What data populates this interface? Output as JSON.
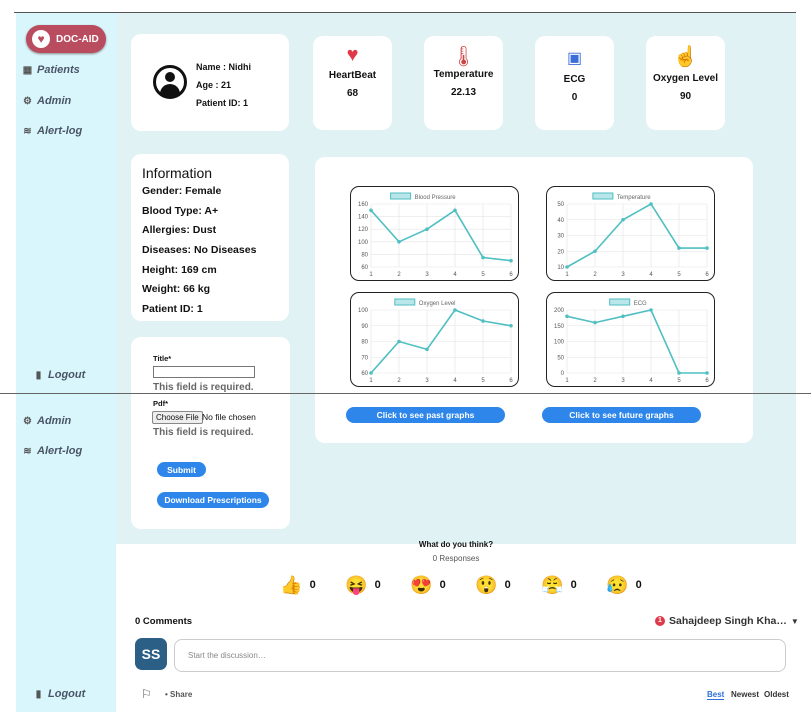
{
  "app": {
    "logo_text": "DOC-AID"
  },
  "nav": {
    "patients": "Patients",
    "admin": "Admin",
    "alert_log": "Alert-log",
    "logout": "Logout"
  },
  "patient": {
    "name": "Name : Nidhi",
    "age": "Age : 21",
    "id": "Patient ID: 1"
  },
  "vitals": [
    {
      "label": "HeartBeat",
      "value": "68",
      "icon": "heart-pulse-icon"
    },
    {
      "label": "Temperature",
      "value": "22.13",
      "icon": "thermometer-icon"
    },
    {
      "label": "ECG",
      "value": "0",
      "icon": "ecg-monitor-icon"
    },
    {
      "label": "Oxygen Level",
      "value": "90",
      "icon": "finger-oximeter-icon"
    }
  ],
  "info": {
    "title": "Information",
    "rows": [
      "Gender: Female",
      "Blood Type: A+",
      "Allergies: Dust",
      "Diseases: No Diseases",
      "Height: 169 cm",
      "Weight: 66 kg",
      "Patient ID: 1"
    ]
  },
  "chart_data": [
    {
      "type": "line",
      "title": "",
      "series": [
        {
          "name": "Blood Pressure",
          "values": [
            150,
            100,
            120,
            150,
            75,
            70
          ]
        }
      ],
      "x": [
        1,
        2,
        3,
        4,
        5,
        6
      ],
      "ylim": [
        60,
        160
      ],
      "yticks": [
        60,
        80,
        100,
        120,
        140,
        160
      ],
      "color": "#4fbfc2"
    },
    {
      "type": "line",
      "title": "",
      "series": [
        {
          "name": "Temperature",
          "values": [
            10,
            20,
            40,
            50,
            22,
            22
          ]
        }
      ],
      "x": [
        1,
        2,
        3,
        4,
        5,
        6
      ],
      "ylim": [
        10,
        50
      ],
      "yticks": [
        10,
        20,
        30,
        40,
        50
      ],
      "color": "#4fbfc2"
    },
    {
      "type": "line",
      "title": "",
      "series": [
        {
          "name": "Oxygen Level",
          "values": [
            60,
            80,
            75,
            100,
            93,
            90
          ]
        }
      ],
      "x": [
        1,
        2,
        3,
        4,
        5,
        6
      ],
      "ylim": [
        60,
        100
      ],
      "yticks": [
        60,
        70,
        80,
        90,
        100
      ],
      "color": "#4fbfc2"
    },
    {
      "type": "line",
      "title": "",
      "series": [
        {
          "name": "ECG",
          "values": [
            180,
            160,
            180,
            200,
            0,
            0
          ]
        }
      ],
      "x": [
        1,
        2,
        3,
        4,
        5,
        6
      ],
      "ylim": [
        0,
        200
      ],
      "yticks": [
        0,
        50,
        100,
        150,
        200
      ],
      "color": "#4fbfc2"
    }
  ],
  "graph_buttons": {
    "past": "Click to see past graphs",
    "future": "Click to see future graphs"
  },
  "form": {
    "title_label": "Title*",
    "pdf_label": "Pdf*",
    "error": "This field is required.",
    "choose_file": "Choose File",
    "no_file": "No file chosen",
    "submit": "Submit",
    "download": "Download Prescriptions"
  },
  "feedback": {
    "question": "What do you think?",
    "responses": "0 Responses",
    "reactions": [
      {
        "emoji": "👍",
        "count": "0"
      },
      {
        "emoji": "😝",
        "count": "0"
      },
      {
        "emoji": "😍",
        "count": "0"
      },
      {
        "emoji": "😲",
        "count": "0"
      },
      {
        "emoji": "😤",
        "count": "0"
      },
      {
        "emoji": "😥",
        "count": "0"
      }
    ]
  },
  "comments": {
    "count": "0 Comments",
    "user": "Sahajdeep Singh Kha…",
    "user_initials": "SS",
    "placeholder": "Start the discussion…",
    "share": "Share",
    "sort": [
      "Best",
      "Newest",
      "Oldest"
    ],
    "notif_count": "1"
  }
}
